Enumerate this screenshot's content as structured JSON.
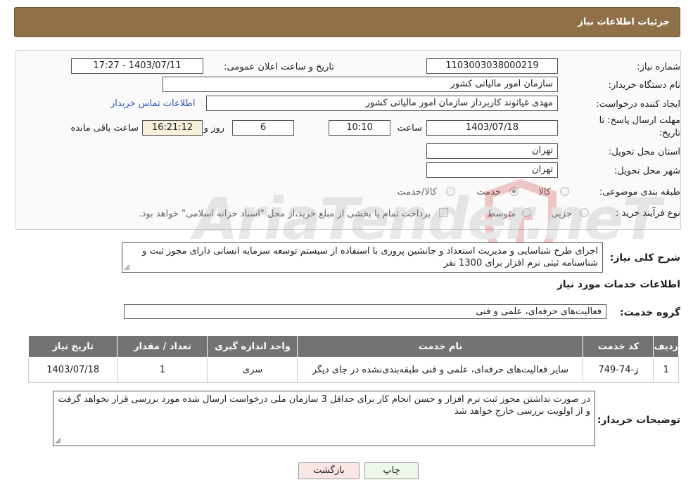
{
  "page": {
    "title": "جزئیات اطلاعات نیاز"
  },
  "form": {
    "need_number_label": "شماره نیاز:",
    "need_number": "1103003038000219",
    "announce_label": "تاریخ و ساعت اعلان عمومی:",
    "announce_value": "1403/07/11 - 17:27",
    "buyer_label": "نام دستگاه خریدار:",
    "buyer_value": "سازمان امور مالیاتی کشور",
    "creator_label": "ایجاد کننده درخواست:",
    "creator_value": "مهدی غیاثوند کاربرداز سازمان امور مالیاتی کشور",
    "contact_link": "اطلاعات تماس خریدار",
    "deadline_label_1": "مهلت ارسال پاسخ: تا",
    "deadline_label_2": "تاریخ:",
    "deadline_date": "1403/07/18",
    "time_label": "ساعت",
    "deadline_time": "10:10",
    "days_value": "6",
    "days_label": "روز و",
    "remaining_time": "16:21:12",
    "remaining_label": "ساعت باقی مانده",
    "province_label": "استان محل تحویل:",
    "province_value": "تهران",
    "city_label": "شهر محل تحویل:",
    "city_value": "تهران",
    "category_label": "طبقه بندی موضوعی:",
    "category_options": [
      "کالا",
      "خدمت",
      "کالا/خدمت"
    ],
    "category_selected": "خدمت",
    "process_label": "نوع فرآیند خرید :",
    "process_options": [
      "جزیی",
      "متوسط"
    ],
    "payment_note": "پرداخت تمام یا بخشی از مبلغ خرید،از محل \"اسناد خزانه اسلامی\" خواهد بود."
  },
  "description": {
    "label": "شرح کلی نیاز:",
    "text": "اجرای طرح شناسایی و مدیریت استعداد و جانشین پروری با استفاده از سیستم توسعه سرمایه انسانی دارای مجوز ثبت و شناسنامه ثبتی نرم افزار  برای 1300 نفر"
  },
  "services": {
    "section_title": "اطلاعات خدمات مورد نیاز",
    "group_label": "گروه خدمت:",
    "group_value": "فعالیت‌های حرفه‌ای، علمی و فنی",
    "table": {
      "headers": [
        "ردیف",
        "کد خدمت",
        "نام خدمت",
        "واحد اندازه گیری",
        "تعداد / مقدار",
        "تاریخ نیاز"
      ],
      "rows": [
        [
          "1",
          "ز-74-749",
          "سایر فعالیت‌های حرفه‌ای، علمی و فنی طبقه‌بندی‌نشده در جای دیگر",
          "سری",
          "1",
          "1403/07/18"
        ]
      ]
    }
  },
  "buyer_notes": {
    "label": "توضیحات خریدار:",
    "text": "در صورت نداشتن مجوز ثبت نرم افزار و حسن انجام کار برای حداقل 3 سازمان ملی درخواست ارسال شده مورد بررسی قرار نخواهد گرفت و از اولویت بررسی خارج خواهد شد"
  },
  "buttons": {
    "print": "چاپ",
    "back": "بازگشت"
  },
  "watermark": {
    "text": "AriaTender.neT"
  },
  "colors": {
    "header_bg": "#8f7048",
    "table_header_bg": "#737373",
    "link": "#2d55b8",
    "print_button_bg": "#eef8ea",
    "back_button_bg": "#fbe6e6"
  }
}
